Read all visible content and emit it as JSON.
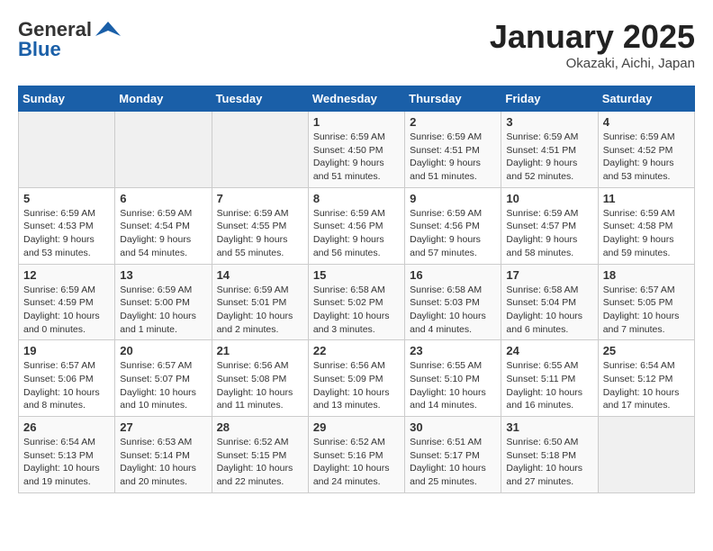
{
  "header": {
    "logo_general": "General",
    "logo_blue": "Blue",
    "month_title": "January 2025",
    "location": "Okazaki, Aichi, Japan"
  },
  "days_of_week": [
    "Sunday",
    "Monday",
    "Tuesday",
    "Wednesday",
    "Thursday",
    "Friday",
    "Saturday"
  ],
  "weeks": [
    [
      {
        "day": "",
        "info": ""
      },
      {
        "day": "",
        "info": ""
      },
      {
        "day": "",
        "info": ""
      },
      {
        "day": "1",
        "info": "Sunrise: 6:59 AM\nSunset: 4:50 PM\nDaylight: 9 hours\nand 51 minutes."
      },
      {
        "day": "2",
        "info": "Sunrise: 6:59 AM\nSunset: 4:51 PM\nDaylight: 9 hours\nand 51 minutes."
      },
      {
        "day": "3",
        "info": "Sunrise: 6:59 AM\nSunset: 4:51 PM\nDaylight: 9 hours\nand 52 minutes."
      },
      {
        "day": "4",
        "info": "Sunrise: 6:59 AM\nSunset: 4:52 PM\nDaylight: 9 hours\nand 53 minutes."
      }
    ],
    [
      {
        "day": "5",
        "info": "Sunrise: 6:59 AM\nSunset: 4:53 PM\nDaylight: 9 hours\nand 53 minutes."
      },
      {
        "day": "6",
        "info": "Sunrise: 6:59 AM\nSunset: 4:54 PM\nDaylight: 9 hours\nand 54 minutes."
      },
      {
        "day": "7",
        "info": "Sunrise: 6:59 AM\nSunset: 4:55 PM\nDaylight: 9 hours\nand 55 minutes."
      },
      {
        "day": "8",
        "info": "Sunrise: 6:59 AM\nSunset: 4:56 PM\nDaylight: 9 hours\nand 56 minutes."
      },
      {
        "day": "9",
        "info": "Sunrise: 6:59 AM\nSunset: 4:56 PM\nDaylight: 9 hours\nand 57 minutes."
      },
      {
        "day": "10",
        "info": "Sunrise: 6:59 AM\nSunset: 4:57 PM\nDaylight: 9 hours\nand 58 minutes."
      },
      {
        "day": "11",
        "info": "Sunrise: 6:59 AM\nSunset: 4:58 PM\nDaylight: 9 hours\nand 59 minutes."
      }
    ],
    [
      {
        "day": "12",
        "info": "Sunrise: 6:59 AM\nSunset: 4:59 PM\nDaylight: 10 hours\nand 0 minutes."
      },
      {
        "day": "13",
        "info": "Sunrise: 6:59 AM\nSunset: 5:00 PM\nDaylight: 10 hours\nand 1 minute."
      },
      {
        "day": "14",
        "info": "Sunrise: 6:59 AM\nSunset: 5:01 PM\nDaylight: 10 hours\nand 2 minutes."
      },
      {
        "day": "15",
        "info": "Sunrise: 6:58 AM\nSunset: 5:02 PM\nDaylight: 10 hours\nand 3 minutes."
      },
      {
        "day": "16",
        "info": "Sunrise: 6:58 AM\nSunset: 5:03 PM\nDaylight: 10 hours\nand 4 minutes."
      },
      {
        "day": "17",
        "info": "Sunrise: 6:58 AM\nSunset: 5:04 PM\nDaylight: 10 hours\nand 6 minutes."
      },
      {
        "day": "18",
        "info": "Sunrise: 6:57 AM\nSunset: 5:05 PM\nDaylight: 10 hours\nand 7 minutes."
      }
    ],
    [
      {
        "day": "19",
        "info": "Sunrise: 6:57 AM\nSunset: 5:06 PM\nDaylight: 10 hours\nand 8 minutes."
      },
      {
        "day": "20",
        "info": "Sunrise: 6:57 AM\nSunset: 5:07 PM\nDaylight: 10 hours\nand 10 minutes."
      },
      {
        "day": "21",
        "info": "Sunrise: 6:56 AM\nSunset: 5:08 PM\nDaylight: 10 hours\nand 11 minutes."
      },
      {
        "day": "22",
        "info": "Sunrise: 6:56 AM\nSunset: 5:09 PM\nDaylight: 10 hours\nand 13 minutes."
      },
      {
        "day": "23",
        "info": "Sunrise: 6:55 AM\nSunset: 5:10 PM\nDaylight: 10 hours\nand 14 minutes."
      },
      {
        "day": "24",
        "info": "Sunrise: 6:55 AM\nSunset: 5:11 PM\nDaylight: 10 hours\nand 16 minutes."
      },
      {
        "day": "25",
        "info": "Sunrise: 6:54 AM\nSunset: 5:12 PM\nDaylight: 10 hours\nand 17 minutes."
      }
    ],
    [
      {
        "day": "26",
        "info": "Sunrise: 6:54 AM\nSunset: 5:13 PM\nDaylight: 10 hours\nand 19 minutes."
      },
      {
        "day": "27",
        "info": "Sunrise: 6:53 AM\nSunset: 5:14 PM\nDaylight: 10 hours\nand 20 minutes."
      },
      {
        "day": "28",
        "info": "Sunrise: 6:52 AM\nSunset: 5:15 PM\nDaylight: 10 hours\nand 22 minutes."
      },
      {
        "day": "29",
        "info": "Sunrise: 6:52 AM\nSunset: 5:16 PM\nDaylight: 10 hours\nand 24 minutes."
      },
      {
        "day": "30",
        "info": "Sunrise: 6:51 AM\nSunset: 5:17 PM\nDaylight: 10 hours\nand 25 minutes."
      },
      {
        "day": "31",
        "info": "Sunrise: 6:50 AM\nSunset: 5:18 PM\nDaylight: 10 hours\nand 27 minutes."
      },
      {
        "day": "",
        "info": ""
      }
    ]
  ]
}
